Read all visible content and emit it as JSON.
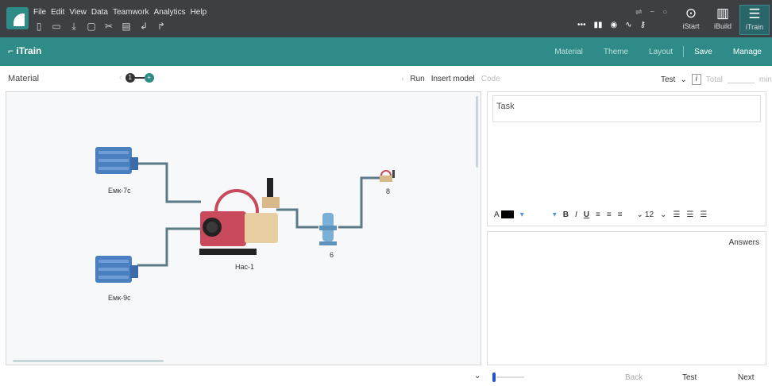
{
  "menu": [
    "File",
    "Edit",
    "View",
    "Data",
    "Teamwork",
    "Analytics",
    "Help"
  ],
  "quick_tools": [
    "new-file-icon",
    "open-folder-icon",
    "import-icon",
    "copy-icon",
    "cut-icon",
    "paste-icon",
    "undo-icon",
    "redo-icon"
  ],
  "modes": {
    "istart": "iStart",
    "ibuild": "iBuild",
    "itrain": "iTrain"
  },
  "brand": "iTrain",
  "nav": {
    "material": "Material",
    "theme": "Theme",
    "layout": "Layout",
    "save": "Save",
    "manage": "Manage"
  },
  "toolbar": {
    "material": "Material",
    "step1": "1",
    "step2": "+",
    "run": "Run",
    "insert_model": "Insert model",
    "code": "Code",
    "test": "Test",
    "total": "Total",
    "min": "min"
  },
  "diagram": {
    "tank1": "Емк-7с",
    "tank2": "Емк-9с",
    "pump": "Нас-1",
    "filter": "6",
    "valve": "8"
  },
  "task": {
    "placeholder": "Task"
  },
  "format": {
    "font_size": "12",
    "bold": "B",
    "italic": "I",
    "underline": "U",
    "color_label": "A"
  },
  "answers": "Answers",
  "footer": {
    "back": "Back",
    "test": "Test",
    "next": "Next"
  },
  "colors": {
    "topbar": "#3c4043",
    "accent": "#2e8b87",
    "tank": "#4a7fc0",
    "pump": "#c94a5c",
    "pipe": "#5c7a85"
  }
}
